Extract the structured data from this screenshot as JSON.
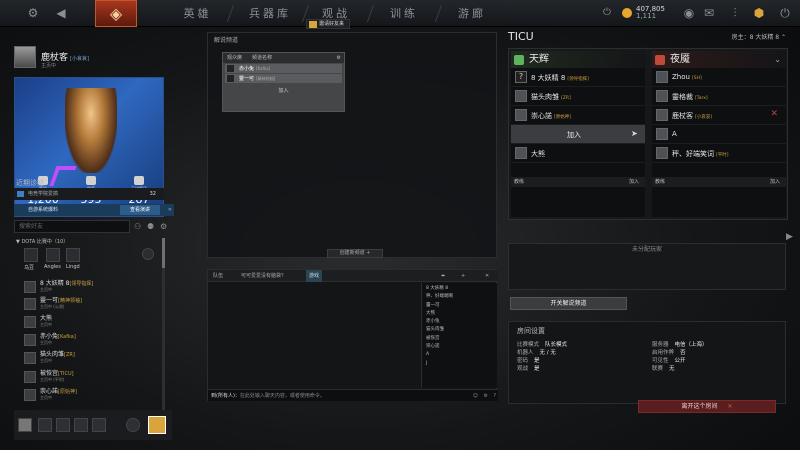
{
  "topbar": {
    "nav_tabs": [
      "英雄",
      "兵器库",
      "观战",
      "训练",
      "游廊"
    ],
    "party_badge": "邀请好友来",
    "gold": "407,805",
    "silver": "1,111"
  },
  "profile": {
    "name": "鹿杖客",
    "tag": "[小哀哀]",
    "status": "主页中"
  },
  "hero_card": {
    "stats": [
      {
        "label": "等级",
        "value": "1,200"
      },
      {
        "label": "徽章",
        "value": "595"
      },
      {
        "label": "天梯等级",
        "value": "287"
      }
    ]
  },
  "recent": {
    "header": "近期诊疑",
    "row_label": "电竞学院爱搞",
    "row_count": "32",
    "notice": "自游系统爆料",
    "notice_button": "查看演讲"
  },
  "friends": {
    "search_placeholder": "搜索好友",
    "group_header": "DOTA 比赛中（10）",
    "hero_labels": [
      "乌豆",
      "Angles",
      "Lingd"
    ],
    "list": [
      {
        "name": "8 大妖精 8",
        "tag": "[领导指挥]",
        "status": "主页中"
      },
      {
        "name": "靈一可",
        "tag": "[精神领袖]",
        "status": "主页中 (公测)"
      },
      {
        "name": "大熊",
        "tag": "",
        "status": "主页中"
      },
      {
        "name": "赤小兔",
        "tag": "[Kafka]",
        "status": "主页中"
      },
      {
        "name": "猫头肉雏",
        "tag": "[ZR]",
        "status": "主页中"
      },
      {
        "name": "被恢宫",
        "tag": "[TICU]",
        "status": "主页中 (平时)"
      },
      {
        "name": "崇心諾",
        "tag": "[原始神]",
        "status": "主页中"
      }
    ]
  },
  "lobby": {
    "title": "解说频道",
    "slot_header_left": "观众席",
    "slot_header_name": "频道名称",
    "slots": [
      {
        "name": "赤小兔",
        "tag": "[Kafka]"
      },
      {
        "name": "靈一可",
        "tag": "[精神领袖]"
      }
    ],
    "join_label": "加入",
    "create_button": "创建新频道 +"
  },
  "chat": {
    "tabs": [
      "队伍",
      "可可爱爱没有脑袋？",
      "游戏"
    ],
    "list": [
      "8 大妖精 8",
      "秤、好端端啊",
      "靈一可",
      "大熊",
      "赤小兔",
      "猫头肉雏",
      "被恢宫",
      "崇心諾",
      "A",
      "J"
    ],
    "input_label": "到(所有人)：",
    "input_placeholder": "在此处输入聊天内容，或者使用命令。"
  },
  "teams": {
    "lobby_name": "TICU",
    "host_label": "房主：8 大妖精 8",
    "radiant": {
      "name": "天辉",
      "players": [
        {
          "name": "8 大妖精 8",
          "tag": "[领导指挥]"
        },
        {
          "name": "猫头肉雏",
          "tag": "[ZR]"
        },
        {
          "name": "崇心諾",
          "tag": "[原始神]"
        }
      ],
      "join_label": "加入",
      "extra": {
        "name": "大熊",
        "tag": ""
      },
      "coach_label": "教练",
      "coach_join": "加入"
    },
    "dire": {
      "name": "夜魇",
      "players": [
        {
          "name": "Zhou",
          "tag": "[SH]"
        },
        {
          "name": "靈格裁",
          "tag": "[Tarx]"
        },
        {
          "name": "鹿杖客",
          "tag": "[小哀哀]"
        },
        {
          "name": "A",
          "tag": ""
        },
        {
          "name": "秤、好端笑词",
          "tag": "[平时]"
        }
      ],
      "coach_label": "教练",
      "coach_join": "加入"
    },
    "unassigned_label": "未分配玩家",
    "open_slot_button": "开关解说频道"
  },
  "settings": {
    "title": "房间设置",
    "rows_left": [
      {
        "label": "比赛模式",
        "value": "队长模式"
      },
      {
        "label": "机器人",
        "value": "无 / 无"
      },
      {
        "label": "密码",
        "value": "是"
      },
      {
        "label": "观战",
        "value": "是"
      }
    ],
    "rows_right": [
      {
        "label": "服务器",
        "value": "电信（上海）"
      },
      {
        "label": "启用作弊",
        "value": "否"
      },
      {
        "label": "可见性",
        "value": "公开"
      },
      {
        "label": "联赛",
        "value": "无"
      }
    ],
    "leave_button": "离开这个房间"
  }
}
